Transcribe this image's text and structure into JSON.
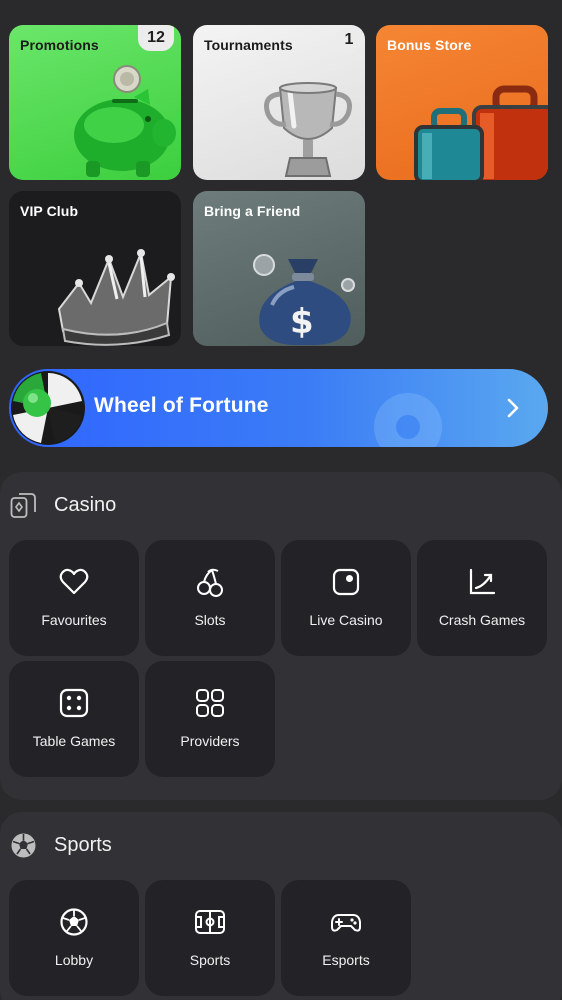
{
  "tiles": {
    "promotions": {
      "label": "Promotions",
      "badge": "12"
    },
    "tournaments": {
      "label": "Tournaments",
      "badge": "1"
    },
    "bonus_store": {
      "label": "Bonus Store"
    },
    "vip_club": {
      "label": "VIP Club"
    },
    "bring_friend": {
      "label": "Bring a Friend"
    }
  },
  "wheel": {
    "title": "Wheel of Fortune"
  },
  "casino": {
    "title": "Casino",
    "items": [
      {
        "label": "Favourites",
        "icon": "heart-icon"
      },
      {
        "label": "Slots",
        "icon": "cherries-icon"
      },
      {
        "label": "Live Casino",
        "icon": "live-casino-icon"
      },
      {
        "label": "Crash Games",
        "icon": "crash-chart-icon"
      },
      {
        "label": "Table Games",
        "icon": "dice-icon"
      },
      {
        "label": "Providers",
        "icon": "grid-icon"
      }
    ]
  },
  "sports": {
    "title": "Sports",
    "items": [
      {
        "label": "Lobby",
        "icon": "soccer-ball-icon"
      },
      {
        "label": "Sports",
        "icon": "football-field-icon"
      },
      {
        "label": "Esports",
        "icon": "gamepad-icon"
      }
    ]
  },
  "colors": {
    "background": "#2a2a2d",
    "panel": "#323236",
    "card": "#232327",
    "promotions_tile": "#4fd94f",
    "bonus_tile": "#ef7728",
    "wheel_banner": "#3b7cf6"
  }
}
